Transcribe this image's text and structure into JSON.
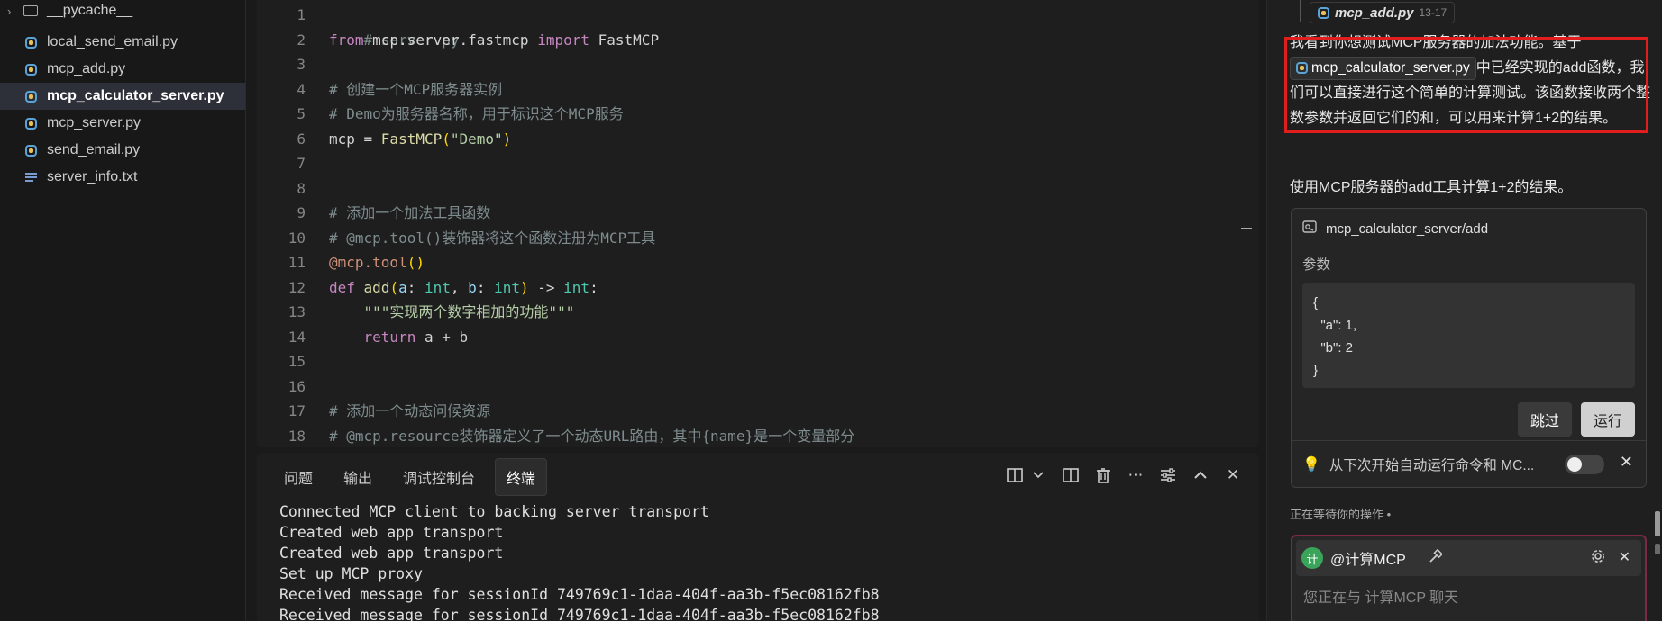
{
  "explorer": {
    "items": [
      {
        "label": "__pycache__",
        "type": "folder"
      },
      {
        "label": "local_send_email.py",
        "type": "py"
      },
      {
        "label": "mcp_add.py",
        "type": "py"
      },
      {
        "label": "mcp_calculator_server.py",
        "type": "py",
        "active": true
      },
      {
        "label": "mcp_server.py",
        "type": "py"
      },
      {
        "label": "send_email.py",
        "type": "py"
      },
      {
        "label": "server_info.txt",
        "type": "txt"
      }
    ]
  },
  "editor": {
    "lines": [
      {
        "n": "1",
        "t": "# server.py"
      },
      {
        "n": "2",
        "t": "from mcp.server.fastmcp import FastMCP"
      },
      {
        "n": "3",
        "t": ""
      },
      {
        "n": "4",
        "t": "# 创建一个MCP服务器实例"
      },
      {
        "n": "5",
        "t": "# Demo为服务器名称，用于标识这个MCP服务"
      },
      {
        "n": "6",
        "t": "mcp = FastMCP(\"Demo\")"
      },
      {
        "n": "7",
        "t": ""
      },
      {
        "n": "8",
        "t": ""
      },
      {
        "n": "9",
        "t": "# 添加一个加法工具函数"
      },
      {
        "n": "10",
        "t": "# @mcp.tool()装饰器将这个函数注册为MCP工具"
      },
      {
        "n": "11",
        "t": "@mcp.tool()"
      },
      {
        "n": "12",
        "t": "def add(a: int, b: int) -> int:"
      },
      {
        "n": "13",
        "t": "    \"\"\"实现两个数字相加的功能\"\"\""
      },
      {
        "n": "14",
        "t": "    return a + b"
      },
      {
        "n": "15",
        "t": ""
      },
      {
        "n": "16",
        "t": ""
      },
      {
        "n": "17",
        "t": "# 添加一个动态问候资源"
      },
      {
        "n": "18",
        "t": "# @mcp.resource装饰器定义了一个动态URL路由，其中{name}是一个变量部分"
      }
    ]
  },
  "panel": {
    "tabs": [
      "问题",
      "输出",
      "调试控制台",
      "终端"
    ],
    "active_tab": "终端",
    "terminal": [
      "Connected MCP client to backing server transport",
      "Created web app transport",
      "Created web app transport",
      "Set up MCP proxy",
      "Received message for sessionId 749769c1-1daa-404f-aa3b-f5ec08162fb8",
      "Received message for sessionId 749769c1-1daa-404f-aa3b-f5ec08162fb8"
    ]
  },
  "chat": {
    "top_chip": {
      "file": "mcp_add.py",
      "lines": "13-17"
    },
    "message_pre": "我看到你想测试MCP服务器的加法功能。基于",
    "message_chip": "mcp_calculator_server.py",
    "message_post": "中已经实现的add函数，我们可以直接进行这个简单的计算测试。该函数接收两个整数参数并返回它们的和，可以用来计算1+2的结果。",
    "prompt": "使用MCP服务器的add工具计算1+2的结果。",
    "tool": {
      "name": "mcp_calculator_server/add",
      "params_label": "参数",
      "json_lines": [
        "{",
        "  \"a\": 1,",
        "  \"b\": 2",
        "}"
      ],
      "skip_label": "跳过",
      "run_label": "运行",
      "auto_run_text": "从下次开始自动运行命令和 MC..."
    },
    "waiting": "正在等待你的操作 •",
    "input": {
      "agent_badge": "计",
      "agent_name": "@计算MCP",
      "placeholder": "您正在与 计算MCP 聊天"
    }
  }
}
